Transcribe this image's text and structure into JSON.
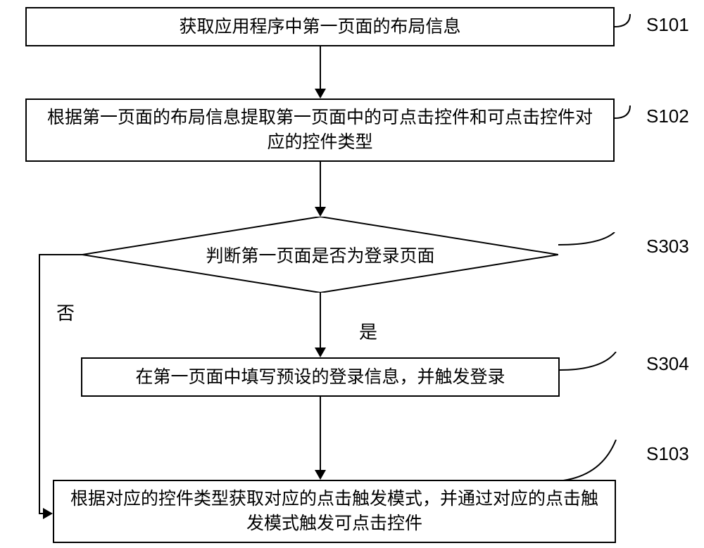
{
  "steps": {
    "s101": {
      "label": "S101",
      "text": "获取应用程序中第一页面的布局信息"
    },
    "s102": {
      "label": "S102",
      "text": "根据第一页面的布局信息提取第一页面中的可点击控件和可点击控件对应的控件类型"
    },
    "s303": {
      "label": "S303",
      "text": "判断第一页面是否为登录页面"
    },
    "s304": {
      "label": "S304",
      "text": "在第一页面中填写预设的登录信息，并触发登录"
    },
    "s103": {
      "label": "S103",
      "text": "根据对应的控件类型获取对应的点击触发模式，并通过对应的点击触发模式触发可点击控件"
    }
  },
  "branches": {
    "no": "否",
    "yes": "是"
  }
}
